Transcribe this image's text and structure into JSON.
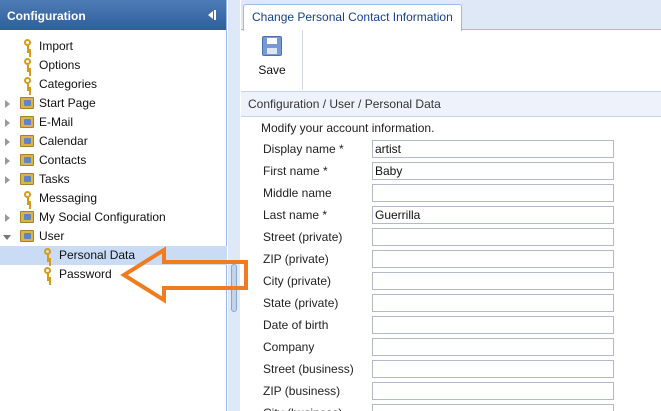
{
  "left_panel": {
    "title": "Configuration",
    "tree": [
      {
        "label": "Import",
        "icon": "key-icon",
        "expandable": false,
        "level": 1
      },
      {
        "label": "Options",
        "icon": "key-icon",
        "expandable": false,
        "level": 1
      },
      {
        "label": "Categories",
        "icon": "key-icon",
        "expandable": false,
        "level": 1
      },
      {
        "label": "Start Page",
        "icon": "folder-icon",
        "expandable": true,
        "expanded": false,
        "level": 1
      },
      {
        "label": "E-Mail",
        "icon": "folder-icon",
        "expandable": true,
        "expanded": false,
        "level": 1
      },
      {
        "label": "Calendar",
        "icon": "folder-icon",
        "expandable": true,
        "expanded": false,
        "level": 1
      },
      {
        "label": "Contacts",
        "icon": "folder-icon",
        "expandable": true,
        "expanded": false,
        "level": 1
      },
      {
        "label": "Tasks",
        "icon": "folder-icon",
        "expandable": true,
        "expanded": false,
        "level": 1
      },
      {
        "label": "Messaging",
        "icon": "key-icon",
        "expandable": false,
        "level": 1
      },
      {
        "label": "My Social Configuration",
        "icon": "folder-icon",
        "expandable": true,
        "expanded": false,
        "level": 1
      },
      {
        "label": "User",
        "icon": "folder-icon",
        "expandable": true,
        "expanded": true,
        "level": 1
      },
      {
        "label": "Personal Data",
        "icon": "key-icon",
        "expandable": false,
        "level": 2,
        "selected": true
      },
      {
        "label": "Password",
        "icon": "key-icon",
        "expandable": false,
        "level": 2
      }
    ]
  },
  "tab": {
    "label": "Change Personal Contact Information"
  },
  "toolbar": {
    "save_label": "Save"
  },
  "breadcrumb": "Configuration / User / Personal Data",
  "form": {
    "intro": "Modify your account information.",
    "fields": [
      {
        "label": "Display name *",
        "value": "artist"
      },
      {
        "label": "First name *",
        "value": "Baby"
      },
      {
        "label": "Middle name",
        "value": ""
      },
      {
        "label": "Last name *",
        "value": "Guerrilla"
      },
      {
        "label": "Street (private)",
        "value": ""
      },
      {
        "label": "ZIP (private)",
        "value": ""
      },
      {
        "label": "City (private)",
        "value": ""
      },
      {
        "label": "State (private)",
        "value": ""
      },
      {
        "label": "Date of birth",
        "value": ""
      },
      {
        "label": "Company",
        "value": ""
      },
      {
        "label": "Street (business)",
        "value": ""
      },
      {
        "label": "ZIP (business)",
        "value": ""
      },
      {
        "label": "City (business)",
        "value": ""
      }
    ]
  },
  "colors": {
    "header_blue": "#2f5f9c",
    "selection": "#c9dbf5",
    "annotation_orange": "#f07c1e"
  }
}
